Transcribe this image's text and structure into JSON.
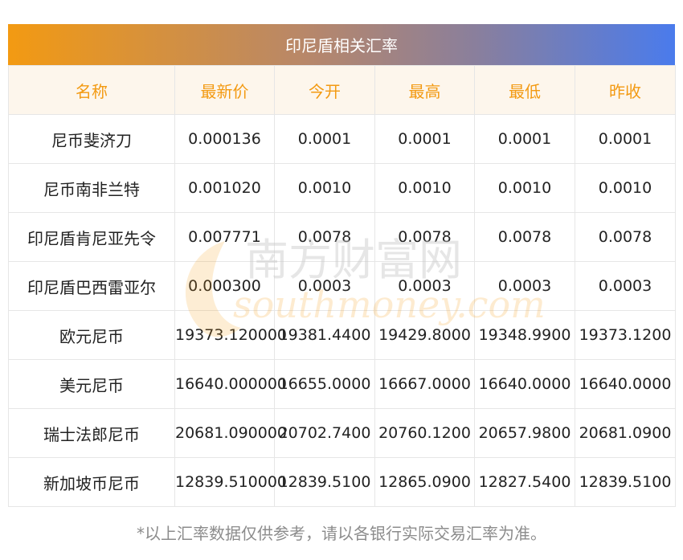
{
  "title": "印尼盾相关汇率",
  "columns": [
    "名称",
    "最新价",
    "今开",
    "最高",
    "最低",
    "昨收"
  ],
  "rows": [
    {
      "name": "尼币斐济刀",
      "latest": "0.000136",
      "open": "0.0001",
      "high": "0.0001",
      "low": "0.0001",
      "prev_close": "0.0001"
    },
    {
      "name": "尼币南非兰特",
      "latest": "0.001020",
      "open": "0.0010",
      "high": "0.0010",
      "low": "0.0010",
      "prev_close": "0.0010"
    },
    {
      "name": "印尼盾肯尼亚先令",
      "latest": "0.007771",
      "open": "0.0078",
      "high": "0.0078",
      "low": "0.0078",
      "prev_close": "0.0078"
    },
    {
      "name": "印尼盾巴西雷亚尔",
      "latest": "0.000300",
      "open": "0.0003",
      "high": "0.0003",
      "low": "0.0003",
      "prev_close": "0.0003"
    },
    {
      "name": "欧元尼币",
      "latest": "19373.120000",
      "open": "19381.4400",
      "high": "19429.8000",
      "low": "19348.9900",
      "prev_close": "19373.1200"
    },
    {
      "name": "美元尼币",
      "latest": "16640.000000",
      "open": "16655.0000",
      "high": "16667.0000",
      "low": "16640.0000",
      "prev_close": "16640.0000"
    },
    {
      "name": "瑞士法郎尼币",
      "latest": "20681.090000",
      "open": "20702.7400",
      "high": "20760.1200",
      "low": "20657.9800",
      "prev_close": "20681.0900"
    },
    {
      "name": "新加坡币尼币",
      "latest": "12839.510000",
      "open": "12839.5100",
      "high": "12865.0900",
      "low": "12827.5400",
      "prev_close": "12839.5100"
    }
  ],
  "watermark": {
    "cn": "南方财富网",
    "en": "southmoney.com"
  },
  "footnote": "*以上汇率数据仅供参考，请以各银行实际交易汇率为准。",
  "colors": {
    "accent": "#f39a12",
    "gradient_end": "#4a7bec",
    "header_bg": "#fdf6ec",
    "footnote": "#8c8c8c"
  }
}
